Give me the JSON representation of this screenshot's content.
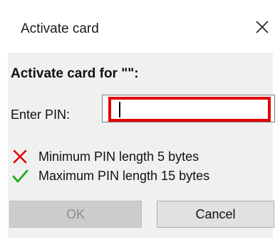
{
  "window": {
    "title": "Activate card",
    "close_icon": "close-icon"
  },
  "main": {
    "heading": "Activate card for \"\":",
    "pin_label": "Enter PIN:",
    "pin_value": "",
    "requirements": [
      {
        "icon": "red-cross-icon",
        "text": "Minimum PIN length 5 bytes",
        "status": "not-met",
        "color": "#e00000"
      },
      {
        "icon": "green-check-icon",
        "text": "Maximum PIN length 15 bytes",
        "status": "met",
        "color": "#1fa81f"
      }
    ]
  },
  "buttons": {
    "ok_label": "OK",
    "ok_enabled": false,
    "cancel_label": "Cancel"
  },
  "colors": {
    "input_highlight": "#e40000",
    "dialog_body_bg": "#f0f0f0"
  }
}
